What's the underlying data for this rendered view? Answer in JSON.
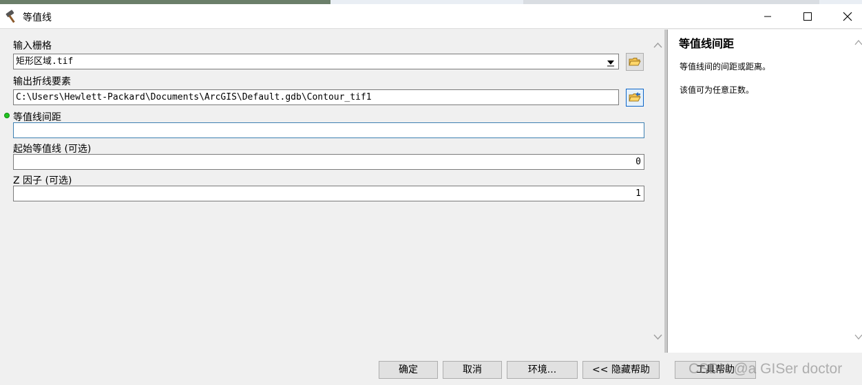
{
  "window": {
    "title": "等值线",
    "icon": "hammer-icon"
  },
  "form": {
    "input_raster": {
      "label": "输入栅格",
      "value": "矩形区域.tif"
    },
    "output_features": {
      "label": "输出折线要素",
      "value": "C:\\Users\\Hewlett-Packard\\Documents\\ArcGIS\\Default.gdb\\Contour_tif1"
    },
    "contour_interval": {
      "label": "等值线间距",
      "value": ""
    },
    "base_contour": {
      "label": "起始等值线 (可选)",
      "value": "0"
    },
    "z_factor": {
      "label": "Z 因子 (可选)",
      "value": "1"
    }
  },
  "help": {
    "title": "等值线间距",
    "paragraphs": [
      "等值线间的间距或距离。",
      "该值可为任意正数。"
    ]
  },
  "buttons": {
    "ok": "确定",
    "cancel": "取消",
    "env": "环境...",
    "hide_help": "<< 隐藏帮助",
    "tool_help": "工具帮助"
  },
  "watermark": "CSDN @a    GISer doctor",
  "colors": {
    "required_dot": "#22c322",
    "focus_border": "#0a64c8"
  }
}
